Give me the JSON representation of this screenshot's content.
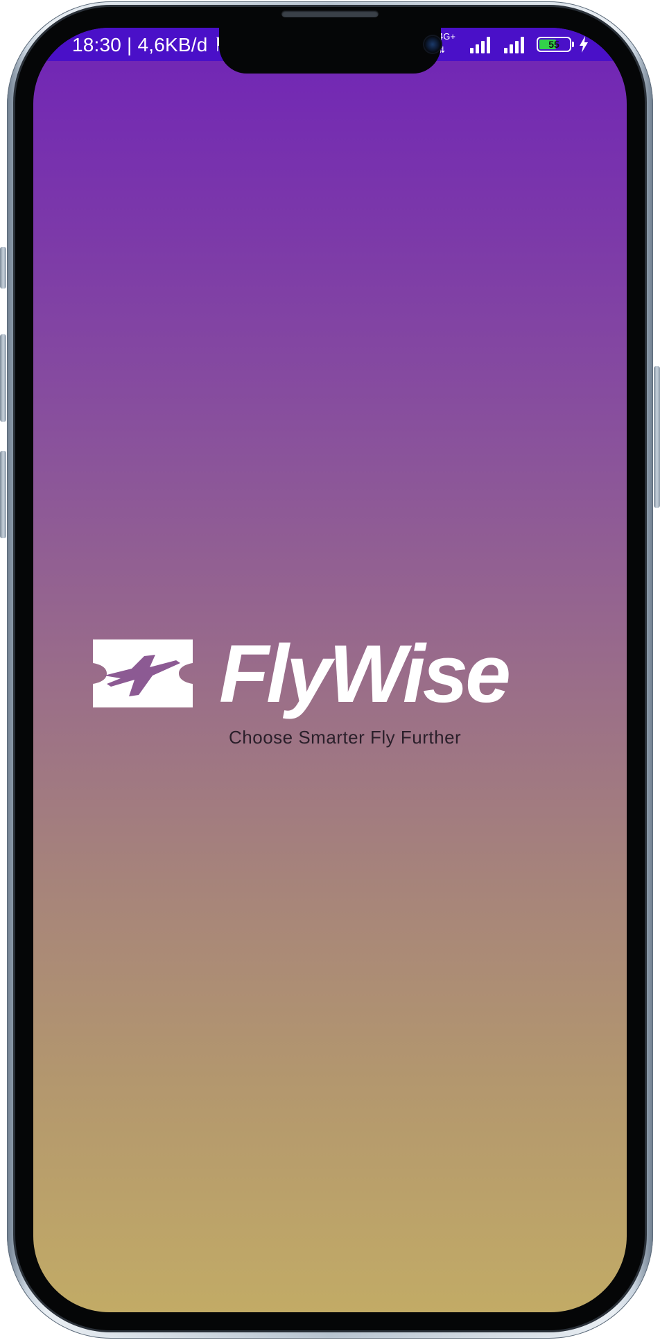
{
  "status_bar": {
    "time_text": "18:30 | 4,6KB/d ⚑",
    "network_type": "4G+",
    "battery_level": "55",
    "charging": true,
    "accent_color": "#4a10c8"
  },
  "splash": {
    "brand_name": "FlyWise",
    "tagline": "Choose Smarter Fly Further",
    "gradient_top": "#7024b7",
    "gradient_bottom": "#c2ab66",
    "logo_icon": "airplane-ticket-icon"
  }
}
